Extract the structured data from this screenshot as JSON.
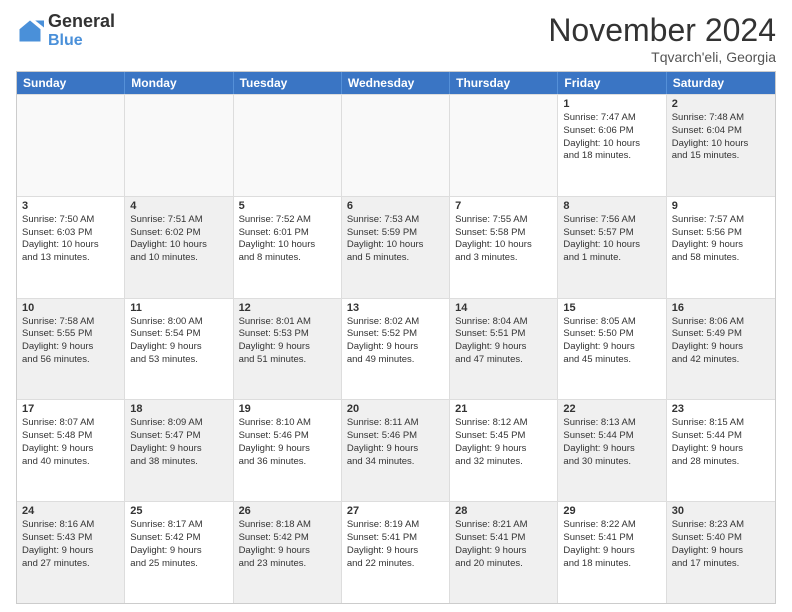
{
  "logo": {
    "line1": "General",
    "line2": "Blue"
  },
  "title": "November 2024",
  "location": "Tqvarch'eli, Georgia",
  "days": [
    "Sunday",
    "Monday",
    "Tuesday",
    "Wednesday",
    "Thursday",
    "Friday",
    "Saturday"
  ],
  "rows": [
    [
      {
        "day": "",
        "empty": true
      },
      {
        "day": "",
        "empty": true
      },
      {
        "day": "",
        "empty": true
      },
      {
        "day": "",
        "empty": true
      },
      {
        "day": "",
        "empty": true
      },
      {
        "day": "1",
        "lines": [
          "Sunrise: 7:47 AM",
          "Sunset: 6:06 PM",
          "Daylight: 10 hours",
          "and 18 minutes."
        ]
      },
      {
        "day": "2",
        "lines": [
          "Sunrise: 7:48 AM",
          "Sunset: 6:04 PM",
          "Daylight: 10 hours",
          "and 15 minutes."
        ],
        "shaded": true
      }
    ],
    [
      {
        "day": "3",
        "lines": [
          "Sunrise: 7:50 AM",
          "Sunset: 6:03 PM",
          "Daylight: 10 hours",
          "and 13 minutes."
        ]
      },
      {
        "day": "4",
        "lines": [
          "Sunrise: 7:51 AM",
          "Sunset: 6:02 PM",
          "Daylight: 10 hours",
          "and 10 minutes."
        ],
        "shaded": true
      },
      {
        "day": "5",
        "lines": [
          "Sunrise: 7:52 AM",
          "Sunset: 6:01 PM",
          "Daylight: 10 hours",
          "and 8 minutes."
        ]
      },
      {
        "day": "6",
        "lines": [
          "Sunrise: 7:53 AM",
          "Sunset: 5:59 PM",
          "Daylight: 10 hours",
          "and 5 minutes."
        ],
        "shaded": true
      },
      {
        "day": "7",
        "lines": [
          "Sunrise: 7:55 AM",
          "Sunset: 5:58 PM",
          "Daylight: 10 hours",
          "and 3 minutes."
        ]
      },
      {
        "day": "8",
        "lines": [
          "Sunrise: 7:56 AM",
          "Sunset: 5:57 PM",
          "Daylight: 10 hours",
          "and 1 minute."
        ],
        "shaded": true
      },
      {
        "day": "9",
        "lines": [
          "Sunrise: 7:57 AM",
          "Sunset: 5:56 PM",
          "Daylight: 9 hours",
          "and 58 minutes."
        ]
      }
    ],
    [
      {
        "day": "10",
        "lines": [
          "Sunrise: 7:58 AM",
          "Sunset: 5:55 PM",
          "Daylight: 9 hours",
          "and 56 minutes."
        ],
        "shaded": true
      },
      {
        "day": "11",
        "lines": [
          "Sunrise: 8:00 AM",
          "Sunset: 5:54 PM",
          "Daylight: 9 hours",
          "and 53 minutes."
        ]
      },
      {
        "day": "12",
        "lines": [
          "Sunrise: 8:01 AM",
          "Sunset: 5:53 PM",
          "Daylight: 9 hours",
          "and 51 minutes."
        ],
        "shaded": true
      },
      {
        "day": "13",
        "lines": [
          "Sunrise: 8:02 AM",
          "Sunset: 5:52 PM",
          "Daylight: 9 hours",
          "and 49 minutes."
        ]
      },
      {
        "day": "14",
        "lines": [
          "Sunrise: 8:04 AM",
          "Sunset: 5:51 PM",
          "Daylight: 9 hours",
          "and 47 minutes."
        ],
        "shaded": true
      },
      {
        "day": "15",
        "lines": [
          "Sunrise: 8:05 AM",
          "Sunset: 5:50 PM",
          "Daylight: 9 hours",
          "and 45 minutes."
        ]
      },
      {
        "day": "16",
        "lines": [
          "Sunrise: 8:06 AM",
          "Sunset: 5:49 PM",
          "Daylight: 9 hours",
          "and 42 minutes."
        ],
        "shaded": true
      }
    ],
    [
      {
        "day": "17",
        "lines": [
          "Sunrise: 8:07 AM",
          "Sunset: 5:48 PM",
          "Daylight: 9 hours",
          "and 40 minutes."
        ]
      },
      {
        "day": "18",
        "lines": [
          "Sunrise: 8:09 AM",
          "Sunset: 5:47 PM",
          "Daylight: 9 hours",
          "and 38 minutes."
        ],
        "shaded": true
      },
      {
        "day": "19",
        "lines": [
          "Sunrise: 8:10 AM",
          "Sunset: 5:46 PM",
          "Daylight: 9 hours",
          "and 36 minutes."
        ]
      },
      {
        "day": "20",
        "lines": [
          "Sunrise: 8:11 AM",
          "Sunset: 5:46 PM",
          "Daylight: 9 hours",
          "and 34 minutes."
        ],
        "shaded": true
      },
      {
        "day": "21",
        "lines": [
          "Sunrise: 8:12 AM",
          "Sunset: 5:45 PM",
          "Daylight: 9 hours",
          "and 32 minutes."
        ]
      },
      {
        "day": "22",
        "lines": [
          "Sunrise: 8:13 AM",
          "Sunset: 5:44 PM",
          "Daylight: 9 hours",
          "and 30 minutes."
        ],
        "shaded": true
      },
      {
        "day": "23",
        "lines": [
          "Sunrise: 8:15 AM",
          "Sunset: 5:44 PM",
          "Daylight: 9 hours",
          "and 28 minutes."
        ]
      }
    ],
    [
      {
        "day": "24",
        "lines": [
          "Sunrise: 8:16 AM",
          "Sunset: 5:43 PM",
          "Daylight: 9 hours",
          "and 27 minutes."
        ],
        "shaded": true
      },
      {
        "day": "25",
        "lines": [
          "Sunrise: 8:17 AM",
          "Sunset: 5:42 PM",
          "Daylight: 9 hours",
          "and 25 minutes."
        ]
      },
      {
        "day": "26",
        "lines": [
          "Sunrise: 8:18 AM",
          "Sunset: 5:42 PM",
          "Daylight: 9 hours",
          "and 23 minutes."
        ],
        "shaded": true
      },
      {
        "day": "27",
        "lines": [
          "Sunrise: 8:19 AM",
          "Sunset: 5:41 PM",
          "Daylight: 9 hours",
          "and 22 minutes."
        ]
      },
      {
        "day": "28",
        "lines": [
          "Sunrise: 8:21 AM",
          "Sunset: 5:41 PM",
          "Daylight: 9 hours",
          "and 20 minutes."
        ],
        "shaded": true
      },
      {
        "day": "29",
        "lines": [
          "Sunrise: 8:22 AM",
          "Sunset: 5:41 PM",
          "Daylight: 9 hours",
          "and 18 minutes."
        ]
      },
      {
        "day": "30",
        "lines": [
          "Sunrise: 8:23 AM",
          "Sunset: 5:40 PM",
          "Daylight: 9 hours",
          "and 17 minutes."
        ],
        "shaded": true
      }
    ]
  ]
}
